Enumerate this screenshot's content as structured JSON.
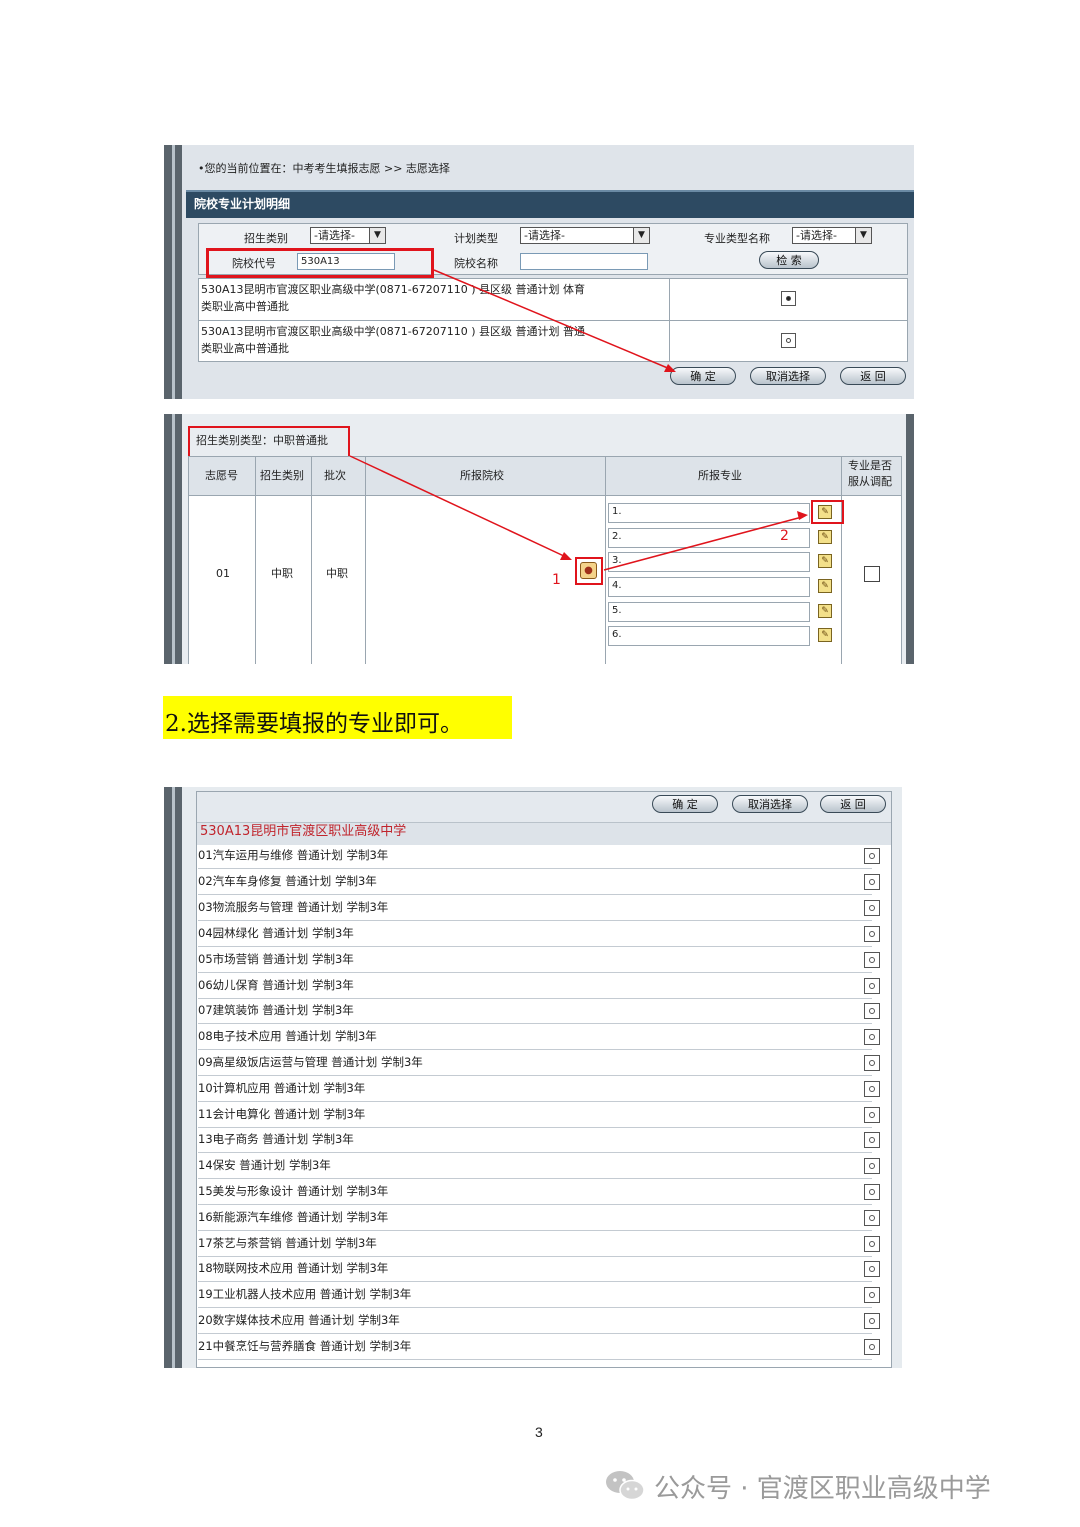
{
  "shot1": {
    "breadcrumb": "•您的当前位置在：中考考生填报志愿 >> 志愿选择",
    "section_title": "院校专业计划明细",
    "filters": {
      "enroll_type_label": "招生类别",
      "enroll_type_value": "-请选择-",
      "plan_type_label": "计划类型",
      "plan_type_value": "-请选择-",
      "major_type_label": "专业类型名称",
      "major_type_value": "-请选择-",
      "school_code_label": "院校代号",
      "school_code_value": "530A13",
      "school_name_label": "院校名称",
      "school_name_value": "",
      "search_button": "检 索"
    },
    "results": [
      {
        "line1": "530A13昆明市官渡区职业高级中学(0871-67207110 )  县区级  普通计划  体育",
        "line2": "类职业高中普通批",
        "selected": true
      },
      {
        "line1": "530A13昆明市官渡区职业高级中学(0871-67207110 )  县区级  普通计划  普通",
        "line2": "类职业高中普通批",
        "selected": false
      }
    ],
    "buttons": {
      "confirm": "确  定",
      "cancel": "取消选择",
      "back": "返  回"
    }
  },
  "shot2": {
    "batch_label": "招生类别类型：中职普通批",
    "headers": {
      "wish_no": "志愿号",
      "enroll_type": "招生类别",
      "batch": "批次",
      "school": "所报院校",
      "major": "所报专业",
      "adjust": "专业是否服从调配"
    },
    "row": {
      "wish_no": "01",
      "enroll_type": "中职",
      "batch": "中职"
    },
    "major_slots": [
      "1.",
      "2.",
      "3.",
      "4.",
      "5.",
      "6."
    ],
    "annotations": {
      "step1": "1",
      "step2": "2"
    }
  },
  "instruction": "2.选择需要填报的专业即可。",
  "shot3": {
    "buttons": {
      "confirm": "确  定",
      "cancel": "取消选择",
      "back": "返  回"
    },
    "school_title": "530A13昆明市官渡区职业高级中学",
    "majors": [
      "01汽车运用与维修  普通计划  学制3年",
      "02汽车车身修复  普通计划  学制3年",
      "03物流服务与管理  普通计划  学制3年",
      "04园林绿化  普通计划  学制3年",
      "05市场营销  普通计划  学制3年",
      "06幼儿保育  普通计划  学制3年",
      "07建筑装饰  普通计划  学制3年",
      "08电子技术应用  普通计划  学制3年",
      "09高星级饭店运营与管理  普通计划  学制3年",
      "10计算机应用  普通计划  学制3年",
      "11会计电算化  普通计划  学制3年",
      "13电子商务  普通计划  学制3年",
      "14保安  普通计划  学制3年",
      "15美发与形象设计  普通计划  学制3年",
      "16新能源汽车维修  普通计划  学制3年",
      "17茶艺与茶营销  普通计划  学制3年",
      "18物联网技术应用  普通计划  学制3年",
      "19工业机器人技术应用  普通计划  学制3年",
      "20数字媒体技术应用  普通计划  学制3年",
      "21中餐烹饪与营养膳食  普通计划  学制3年"
    ]
  },
  "page_number": "3",
  "watermark": "公众号 · 官渡区职业高级中学",
  "colors": {
    "accent_red": "#e0141c",
    "highlight": "#ffff00",
    "title_bar": "#2d4a62",
    "school_red": "#c0242c"
  }
}
